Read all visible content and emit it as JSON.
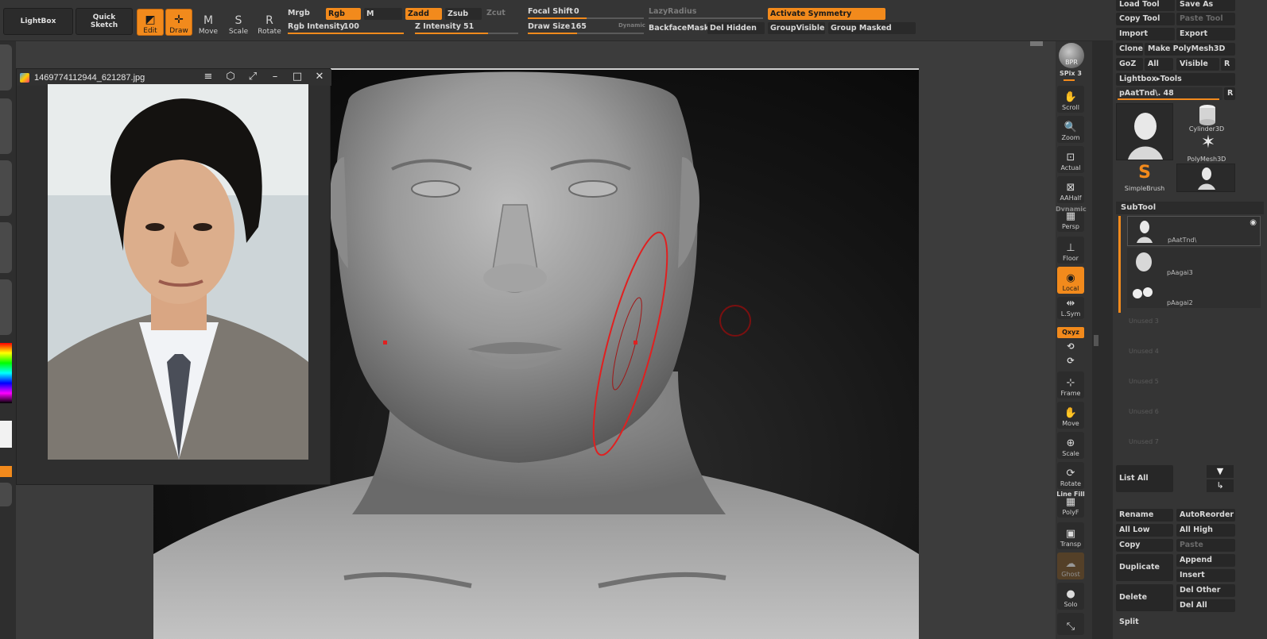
{
  "top_left": {
    "lightbox": "LightBox",
    "quick_sketch_1": "Quick",
    "quick_sketch_2": "Sketch"
  },
  "modes": [
    {
      "label": "Edit",
      "glyph": "◩",
      "on": true
    },
    {
      "label": "Draw",
      "glyph": "✛",
      "on": true
    },
    {
      "label": "Move",
      "glyph": "M",
      "on": false
    },
    {
      "label": "Scale",
      "glyph": "S",
      "on": false
    },
    {
      "label": "Rotate",
      "glyph": "R",
      "on": false
    }
  ],
  "color_row": {
    "mrgb": "Mrgb",
    "rgb": "Rgb",
    "m": "M",
    "zadd": "Zadd",
    "zsub": "Zsub",
    "zcut": "Zcut"
  },
  "rgb_intensity": {
    "label": "Rgb Intensity",
    "value": "100"
  },
  "z_intensity": {
    "label": "Z Intensity",
    "value": "51"
  },
  "focal_shift": {
    "label": "Focal Shift",
    "value": "0"
  },
  "draw_size": {
    "label": "Draw Size",
    "value": "165",
    "dynamic": "Dynamic"
  },
  "lazy_radius": "LazyRadius",
  "activate_symmetry": "Activate Symmetry",
  "backface_mask": "BackfaceMask",
  "del_hidden": "Del Hidden",
  "group_visible": "GroupVisible",
  "group_masked": "Group Masked",
  "ref_window": {
    "filename": "1469774112944_621287.jpg",
    "menu_icon": "≡",
    "pin_icon": "⬡",
    "fit_icon": "⤢",
    "min_icon": "–",
    "max_icon": "□",
    "close_icon": "✕"
  },
  "right_toolbar": {
    "bpr": "BPR",
    "spix": "SPix 3",
    "buttons": [
      {
        "name": "scroll",
        "label": "Scroll",
        "glyph": "✋"
      },
      {
        "name": "zoom",
        "label": "Zoom",
        "glyph": "🔍"
      },
      {
        "name": "actual",
        "label": "Actual",
        "glyph": "⊡"
      },
      {
        "name": "aahalf",
        "label": "AAHalf",
        "glyph": "⊠"
      },
      {
        "name": "persp",
        "label": "Persp",
        "glyph": "▦"
      },
      {
        "name": "floor",
        "label": "Floor",
        "glyph": "⊥"
      },
      {
        "name": "local",
        "label": "Local",
        "glyph": "◉"
      },
      {
        "name": "lsym",
        "label": "L.Sym",
        "glyph": "⇹"
      },
      {
        "name": "frame",
        "label": "Frame",
        "glyph": "⊹"
      },
      {
        "name": "move",
        "label": "Move",
        "glyph": "✋"
      },
      {
        "name": "scale",
        "label": "Scale",
        "glyph": "⊕"
      },
      {
        "name": "rotate",
        "label": "Rotate",
        "glyph": "⟳"
      },
      {
        "name": "polyf",
        "label": "PolyF",
        "glyph": "▦"
      },
      {
        "name": "transp",
        "label": "Transp",
        "glyph": "▣"
      },
      {
        "name": "ghost",
        "label": "Ghost",
        "glyph": "☁"
      },
      {
        "name": "solo",
        "label": "Solo",
        "glyph": "●"
      }
    ],
    "dynamic": "Dynamic",
    "line_fill": "Line Fill",
    "xyz": "Qxyz"
  },
  "right_panel": {
    "load_tool": "Load Tool",
    "save_as": "Save As",
    "copy_tool": "Copy Tool",
    "paste_tool": "Paste Tool",
    "import": "Import",
    "export": "Export",
    "clone": "Clone",
    "make_polymesh": "Make PolyMesh3D",
    "goz": "GoZ",
    "all": "All",
    "visible": "Visible",
    "r": "R",
    "lightbox_tools": "Lightbox▸Tools",
    "tool_name": "pAatTnd\\. 48",
    "tools": [
      {
        "name": "pAatTnd\\",
        "caption": ""
      },
      {
        "name": "Cylinder3D",
        "caption": "Cylinder3D"
      },
      {
        "name": "PolyMesh3D",
        "caption": "PolyMesh3D"
      },
      {
        "name": "SimpleBrush",
        "caption": "SimpleBrush"
      },
      {
        "name": "pAatTnd\\",
        "caption": "pAatTnd\\"
      }
    ],
    "subtool_header": "SubTool",
    "subtools": [
      {
        "name": "pAatTnd\\"
      },
      {
        "name": "pAagai3"
      },
      {
        "name": "pAagai2"
      }
    ],
    "unused": [
      "Unused 3",
      "Unused 4",
      "Unused 5",
      "Unused 6",
      "Unused 7"
    ],
    "list_all": "List All",
    "rename": "Rename",
    "auto_reorder": "AutoReorder",
    "all_low": "All Low",
    "all_high": "All High",
    "copy": "Copy",
    "paste": "Paste",
    "duplicate": "Duplicate",
    "append": "Append",
    "insert": "Insert",
    "delete": "Delete",
    "del_other": "Del Other",
    "del_all": "Del All",
    "split": "Split"
  }
}
